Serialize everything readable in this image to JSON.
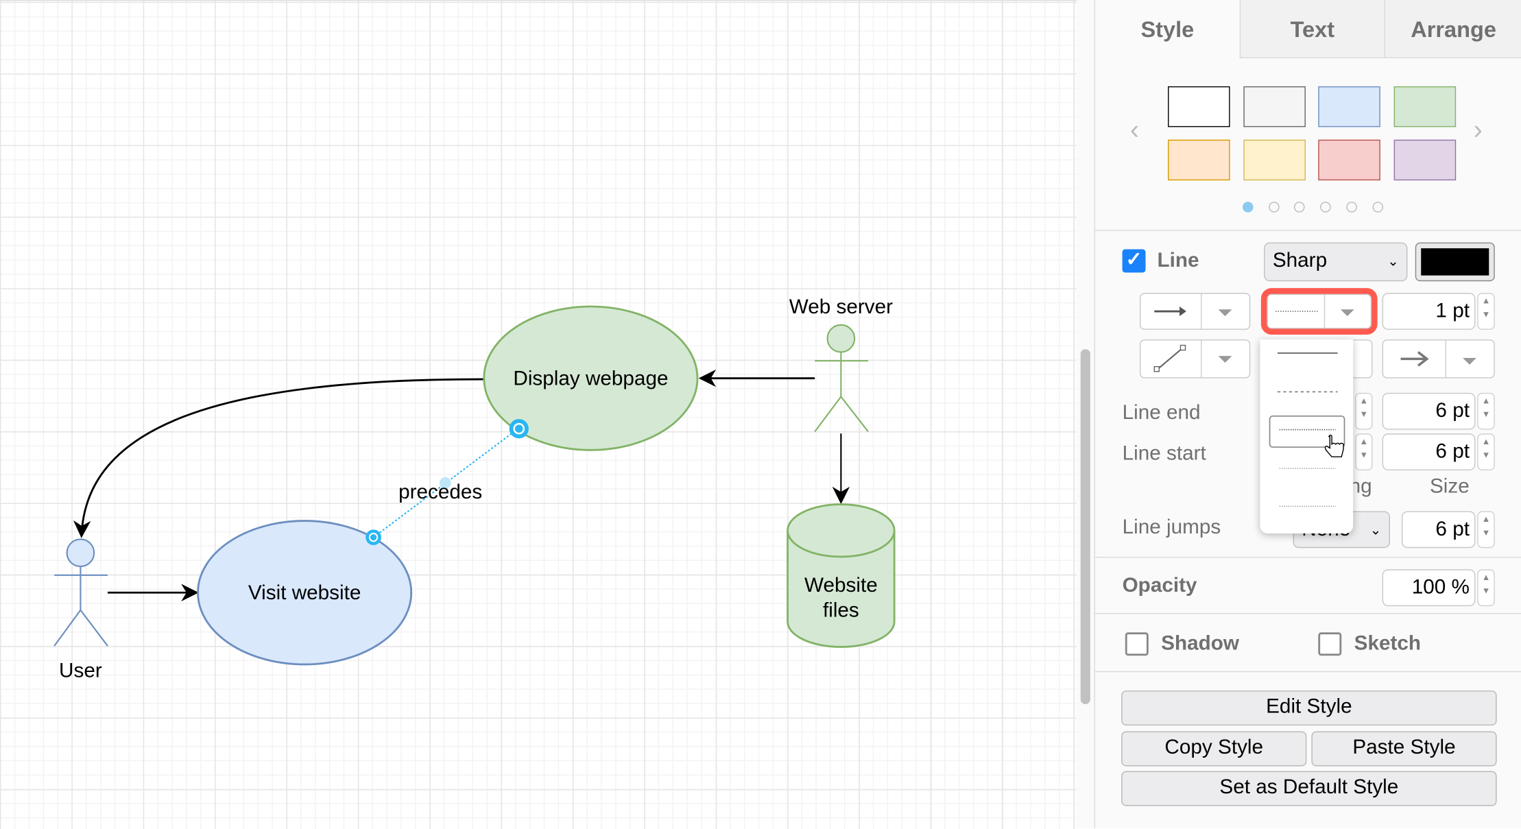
{
  "diagram": {
    "nodes": {
      "display": "Display webpage",
      "visit": "Visit website",
      "files_line1": "Website",
      "files_line2": "files",
      "user": "User",
      "webserver": "Web server"
    },
    "edge_label": "precedes",
    "colors": {
      "green_fill": "#d5e8d4",
      "green_stroke": "#82b366",
      "blue_fill": "#dae8fc",
      "blue_stroke": "#6c8ebf",
      "selection": "#29b6f2"
    }
  },
  "panel": {
    "tabs": [
      {
        "label": "Style",
        "active": true
      },
      {
        "label": "Text",
        "active": false
      },
      {
        "label": "Arrange",
        "active": false
      }
    ],
    "swatches": [
      {
        "fill": "#ffffff",
        "stroke": "#000000"
      },
      {
        "fill": "#f5f5f5",
        "stroke": "#666666"
      },
      {
        "fill": "#dae8fc",
        "stroke": "#6c8ebf"
      },
      {
        "fill": "#d5e8d4",
        "stroke": "#82b366"
      },
      {
        "fill": "#ffe6cc",
        "stroke": "#d79b00"
      },
      {
        "fill": "#fff2cc",
        "stroke": "#d6b656"
      },
      {
        "fill": "#f8cecc",
        "stroke": "#b85450"
      },
      {
        "fill": "#e1d5e7",
        "stroke": "#9673a6"
      }
    ],
    "swatch_page": 1,
    "swatch_pages": 6,
    "line": {
      "label": "Line",
      "checked": true,
      "style_value": "Sharp",
      "color": "#000000",
      "width": "1 pt",
      "pattern": "dotted"
    },
    "line_end": {
      "label": "Line end",
      "size": "6 pt"
    },
    "line_start": {
      "label": "Line start",
      "size": "6 pt"
    },
    "spacing_partial": "ng",
    "size_label": "Size",
    "line_jumps": {
      "label": "Line jumps",
      "value": "None",
      "size": "6 pt"
    },
    "opacity": {
      "label": "Opacity",
      "value": "100 %"
    },
    "shadow": {
      "label": "Shadow",
      "checked": false
    },
    "sketch": {
      "label": "Sketch",
      "checked": false
    },
    "buttons": {
      "edit": "Edit Style",
      "copy": "Copy Style",
      "paste": "Paste Style",
      "default": "Set as Default Style"
    },
    "pattern_menu": [
      "solid",
      "dashed",
      "dotted",
      "dotted-fine",
      "dotted-sparse"
    ],
    "highlight_color": "#ff5a4f"
  }
}
